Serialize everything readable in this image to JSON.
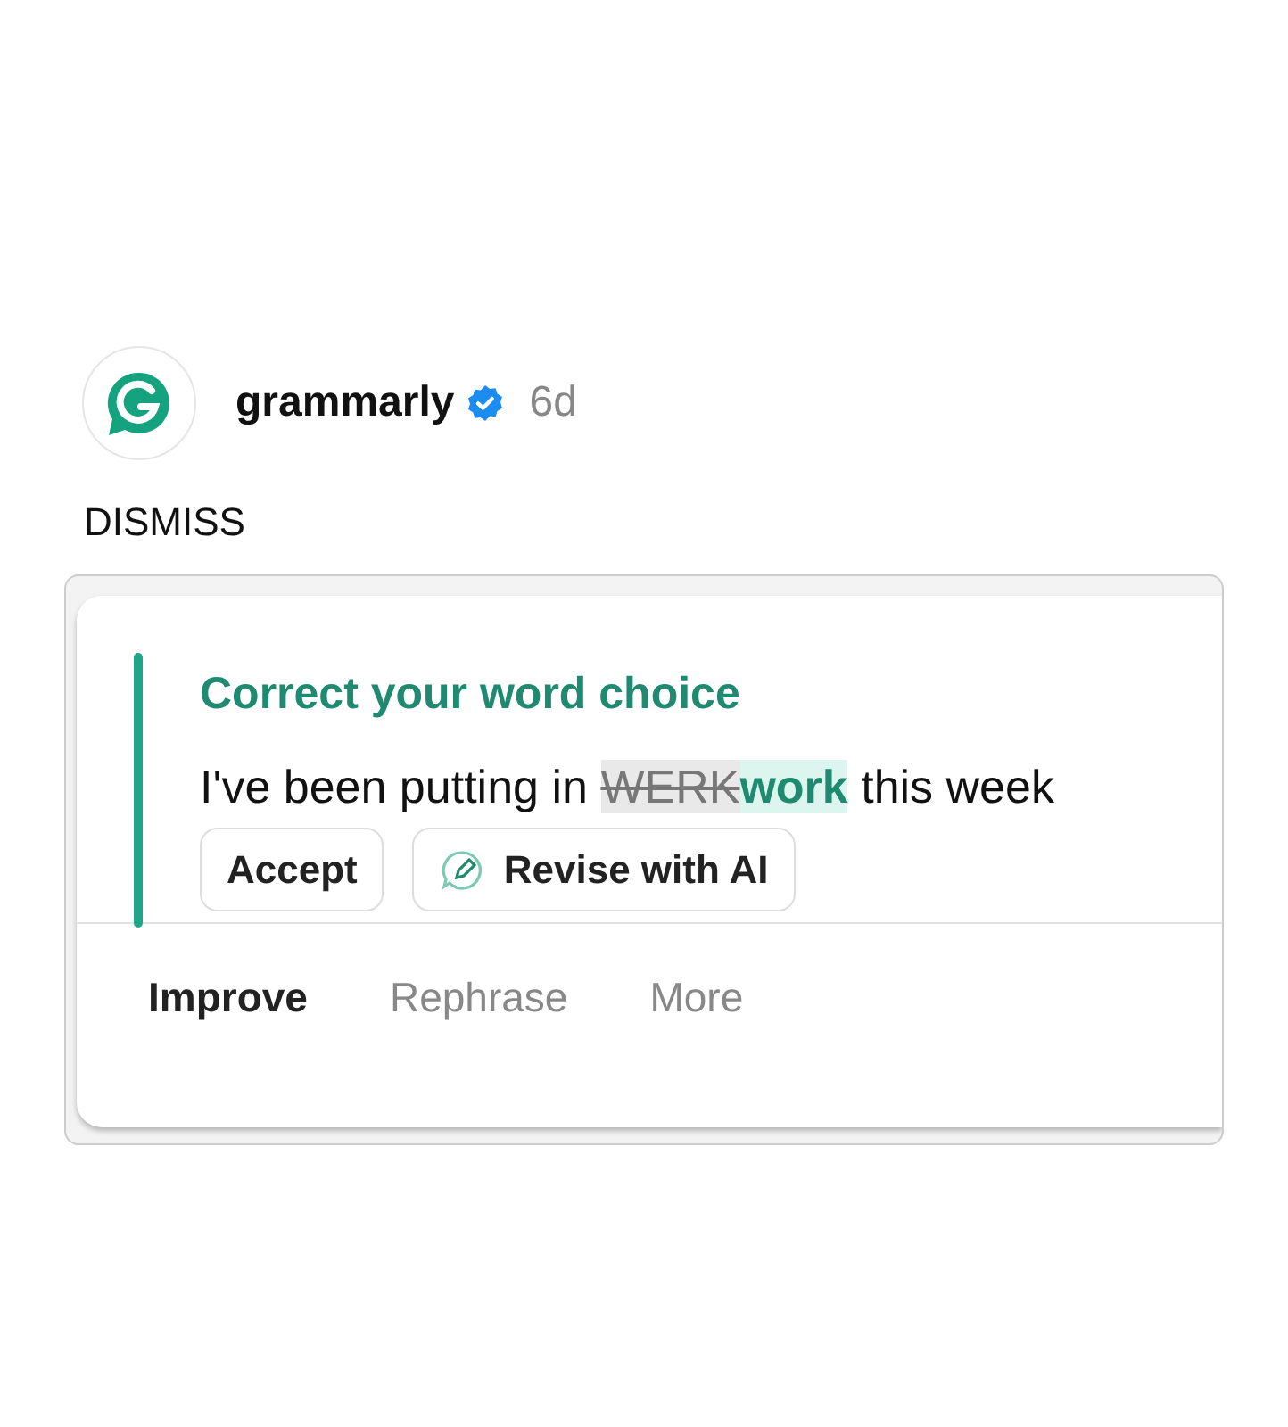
{
  "post": {
    "author": "grammarly",
    "verified": true,
    "time": "6d"
  },
  "dismiss": "DISMISS",
  "card": {
    "title": "Correct your word choice",
    "sentence": {
      "before": "I've been putting in ",
      "removed": "WERK",
      "inserted": "work",
      "after": " this week"
    },
    "buttons": [
      {
        "kind": "plain",
        "label": "Accept"
      },
      {
        "kind": "ai",
        "label": "Revise with AI"
      }
    ],
    "tabs": [
      {
        "label": "Improve",
        "selected": true
      },
      {
        "label": "Rephrase",
        "selected": false
      },
      {
        "label": "More",
        "selected": false
      }
    ]
  }
}
